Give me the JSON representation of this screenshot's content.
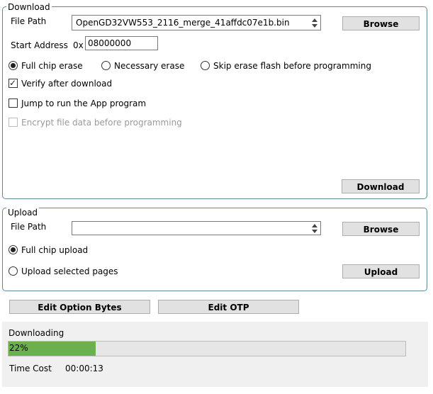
{
  "download": {
    "title": "Download",
    "file_path_label": "File Path",
    "file_path_value": "OpenGD32VW553_2116_merge_41affdc07e1b.bin",
    "browse_label": "Browse",
    "start_address_label": "Start Address",
    "address_prefix": "0x",
    "address_value": "08000000",
    "erase_options": [
      "Full chip erase",
      "Necessary erase",
      "Skip erase flash before programming"
    ],
    "erase_selected": "Full chip erase",
    "verify_label": "Verify after download",
    "verify_checked": true,
    "jump_label": "Jump to run the App program",
    "jump_checked": false,
    "encrypt_label": "Encrypt file data before programming",
    "encrypt_checked": false,
    "download_button": "Download"
  },
  "upload": {
    "title": "Upload",
    "file_path_label": "File Path",
    "file_path_value": "",
    "browse_label": "Browse",
    "full_chip_label": "Full chip upload",
    "selected_pages_label": "Upload selected pages",
    "selected": "Full chip upload",
    "upload_button": "Upload"
  },
  "actions": {
    "edit_option_bytes": "Edit Option Bytes",
    "edit_otp": "Edit OTP"
  },
  "status": {
    "state_label": "Downloading",
    "progress_text": "22%",
    "progress_fraction": 0.22,
    "time_cost_label": "Time Cost",
    "time_cost_value": "00:00:13",
    "progress_color": "#6ab04c"
  }
}
